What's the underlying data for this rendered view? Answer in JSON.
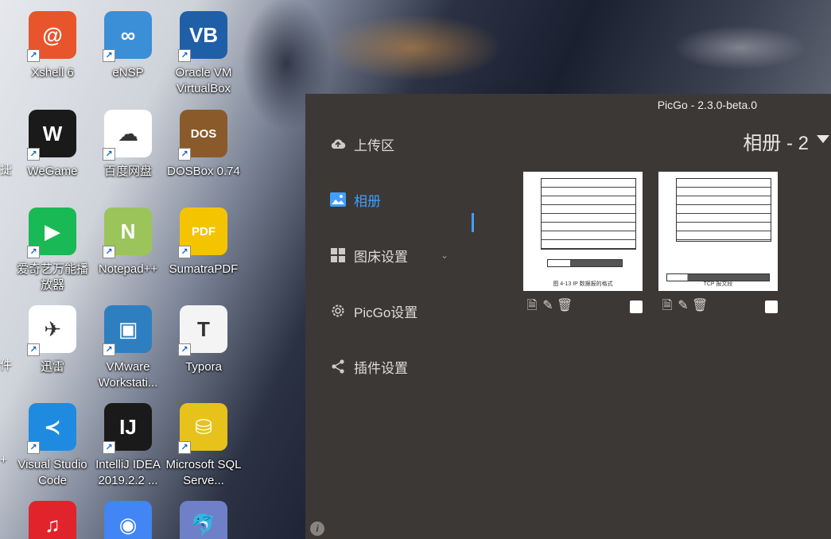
{
  "desktop": {
    "icons": [
      {
        "label": "Xshell 6",
        "icon": "xshell-icon",
        "color": "#e8542b",
        "glyph": "@"
      },
      {
        "label": "eNSP",
        "icon": "ensp-icon",
        "color": "#3b8fd6",
        "glyph": "∞"
      },
      {
        "label": "Oracle VM VirtualBox",
        "icon": "virtualbox-icon",
        "color": "#1f5fa8",
        "glyph": "VB"
      },
      {
        "label": "WeGame",
        "icon": "wegame-icon",
        "color": "#1a1a1a",
        "glyph": "W"
      },
      {
        "label": "百度网盘",
        "icon": "baidu-netdisk-icon",
        "color": "#ffffff",
        "glyph": "☁"
      },
      {
        "label": "DOSBox 0.74",
        "icon": "dosbox-icon",
        "color": "#8a5a2b",
        "glyph": "DOS"
      },
      {
        "label": "爱奇艺万能播放器",
        "icon": "iqiyi-icon",
        "color": "#19b955",
        "glyph": "▶"
      },
      {
        "label": "Notepad++",
        "icon": "notepadpp-icon",
        "color": "#9bc45a",
        "glyph": "N"
      },
      {
        "label": "SumatraPDF",
        "icon": "sumatrapdf-icon",
        "color": "#f5c400",
        "glyph": "PDF"
      },
      {
        "label": "迅雷",
        "icon": "xunlei-icon",
        "color": "#ffffff",
        "glyph": "✈"
      },
      {
        "label": "VMware Workstati...",
        "icon": "vmware-icon",
        "color": "#2e7fc0",
        "glyph": "▣"
      },
      {
        "label": "Typora",
        "icon": "typora-icon",
        "color": "#f4f4f4",
        "glyph": "T"
      },
      {
        "label": "Visual Studio Code",
        "icon": "vscode-icon",
        "color": "#1e8be0",
        "glyph": "≺"
      },
      {
        "label": "IntelliJ IDEA 2019.2.2 ...",
        "icon": "intellij-icon",
        "color": "#1a1a1a",
        "glyph": "IJ"
      },
      {
        "label": "Microsoft SQL Serve...",
        "icon": "sqlserver-icon",
        "color": "#e7c21a",
        "glyph": "⛁"
      },
      {
        "label": "",
        "icon": "netease-music-icon",
        "color": "#e1232c",
        "glyph": "♫"
      },
      {
        "label": "",
        "icon": "chrome-icon",
        "color": "#4285f4",
        "glyph": "◉"
      },
      {
        "label": "",
        "icon": "mysql-dolphin-icon",
        "color": "#6f7fc8",
        "glyph": "🐬"
      }
    ],
    "edge_labels": [
      "捷",
      "件",
      "+"
    ]
  },
  "picgo": {
    "title": "PicGo - 2.3.0-beta.0",
    "nav": [
      {
        "label": "上传区",
        "icon": "cloud-upload-icon"
      },
      {
        "label": "相册",
        "icon": "image-icon",
        "active": true
      },
      {
        "label": "图床设置",
        "icon": "grid-icon",
        "expandable": true
      },
      {
        "label": "PicGo设置",
        "icon": "gear-icon"
      },
      {
        "label": "插件设置",
        "icon": "share-icon"
      }
    ],
    "album_title": "相册 - 2",
    "accent": "#409eff",
    "photos": [
      {
        "caption": "图 4-13 IP 数据报的格式"
      },
      {
        "caption": "TCP 报文段"
      }
    ]
  }
}
